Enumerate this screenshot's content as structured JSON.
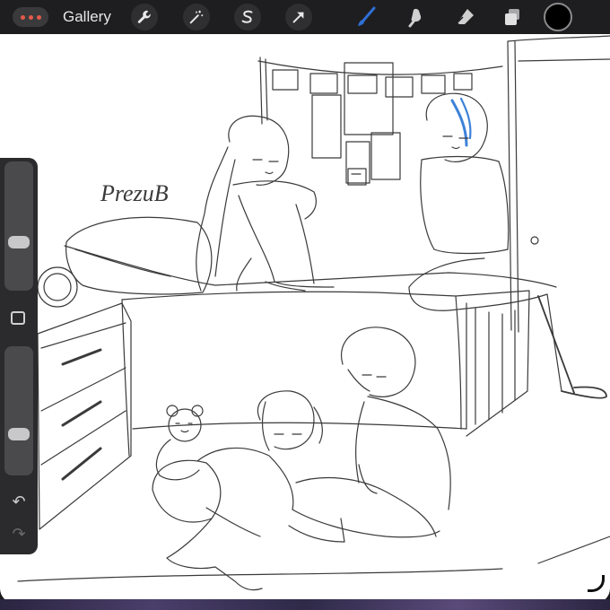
{
  "topbar": {
    "menu_icon": "more-dots-icon",
    "gallery_label": "Gallery",
    "actions": [
      "wrench-icon",
      "magic-wand-icon",
      "selection-s-icon",
      "move-arrow-icon"
    ],
    "tools": [
      "brush-icon",
      "smudge-icon",
      "eraser-icon",
      "layers-icon"
    ],
    "current_color": "#000000",
    "active_tool_color": "#2f6fd6"
  },
  "sidebar": {
    "brush_size_level": 0.35,
    "opacity_level": 0.28,
    "modify_icon": "square-icon",
    "undo_icon": "undo-icon",
    "redo_icon": "redo-icon"
  },
  "canvas": {
    "signature_text": "PrezuB",
    "background": "#ffffff",
    "sketch_ink": "#3a3a3a",
    "hair_accent": "#3d82d8"
  }
}
